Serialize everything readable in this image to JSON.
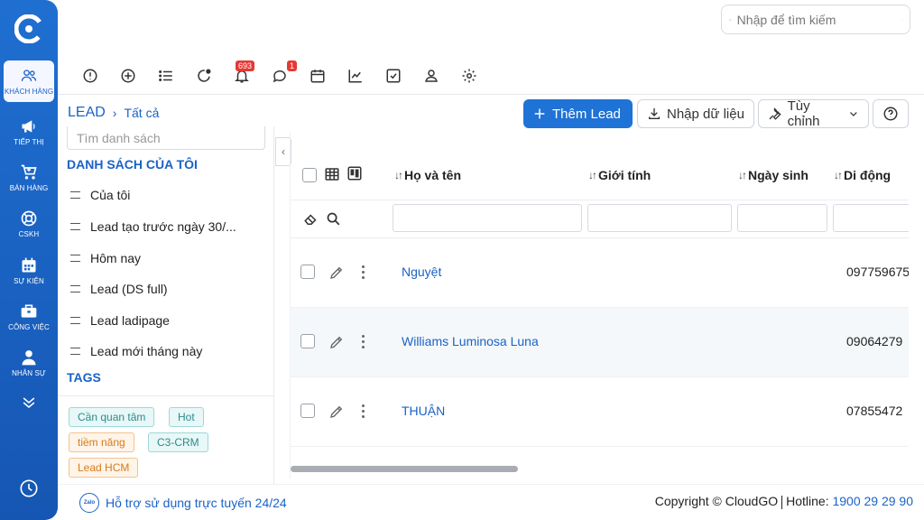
{
  "search": {
    "placeholder": "Nhập để tìm kiếm"
  },
  "rail": {
    "items": [
      {
        "label": "KHÁCH HÀNG",
        "icon": "users-icon"
      },
      {
        "label": "TIẾP THỊ",
        "icon": "megaphone-icon"
      },
      {
        "label": "BÁN HÀNG",
        "icon": "cart-icon"
      },
      {
        "label": "CSKH",
        "icon": "lifebuoy-icon"
      },
      {
        "label": "SỰ KIỆN",
        "icon": "calendar-icon"
      },
      {
        "label": "CÔNG VIỆC",
        "icon": "briefcase-icon"
      },
      {
        "label": "NHÂN SỰ",
        "icon": "person-icon"
      }
    ]
  },
  "toolbar": {
    "notifications_count": "693",
    "messages_count": "1"
  },
  "breadcrumb": {
    "module": "LEAD",
    "view": "Tất cả"
  },
  "actions": {
    "add_lead": "Thêm Lead",
    "import": "Nhập dữ liệu",
    "customize": "Tùy chỉnh"
  },
  "left_panel": {
    "search_placeholder": "Tìm danh sách",
    "my_lists_heading": "DANH SÁCH CỦA TÔI",
    "lists": [
      "Của tôi",
      "Lead tạo trước ngày 30/...",
      "Hôm nay",
      "Lead (DS full)",
      "Lead ladipage",
      "Lead mới tháng này"
    ],
    "tags_heading": "TAGS",
    "tags": [
      {
        "label": "Cần quan tâm",
        "color": "#2c8c8c"
      },
      {
        "label": "Hot",
        "color": "#2c8c8c"
      },
      {
        "label": "tiềm năng",
        "color": "#d77a1a"
      },
      {
        "label": "C3-CRM",
        "color": "#2c8c8c"
      },
      {
        "label": "Lead HCM",
        "color": "#d77a1a"
      }
    ]
  },
  "table": {
    "columns": [
      "Họ và tên",
      "Giới tính",
      "Ngày sinh",
      "Di động"
    ],
    "rows": [
      {
        "name": "Nguyệt",
        "phone": "097759675"
      },
      {
        "name": "Williams Luminosa Luna",
        "phone": "09064279"
      },
      {
        "name": "THUẬN",
        "phone": "07855472"
      }
    ],
    "scroll_position_fraction": 0
  },
  "footer": {
    "zalo_label": "Zalo",
    "help_text": "Hỗ trợ sử dụng trực tuyến 24/24",
    "copyright": "Copyright © CloudGO",
    "hotline_label": "Hotline:",
    "hotline_number": "1900 29 29 90"
  },
  "colors": {
    "brand": "#1f73d6",
    "rail": "#1a62c7",
    "badge": "#e53935"
  }
}
